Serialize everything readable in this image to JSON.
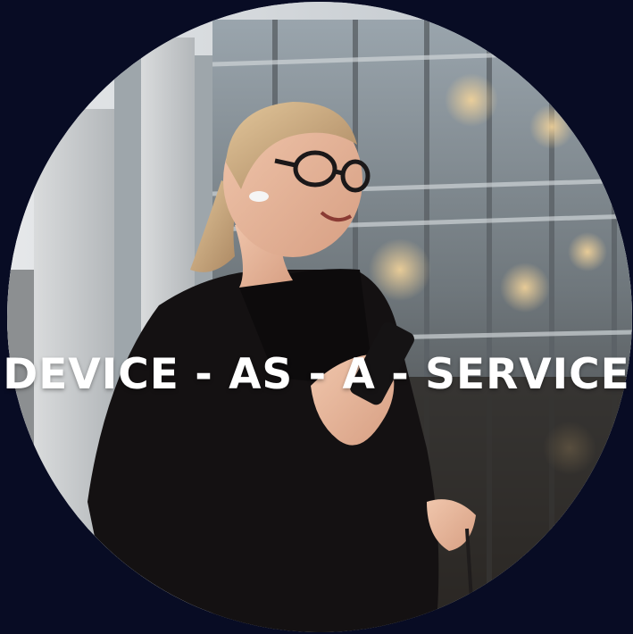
{
  "headline": {
    "text": "DEVICE - AS - A - SERVICE"
  },
  "colors": {
    "page_background": "#080c24",
    "headline_text": "#ffffff"
  }
}
